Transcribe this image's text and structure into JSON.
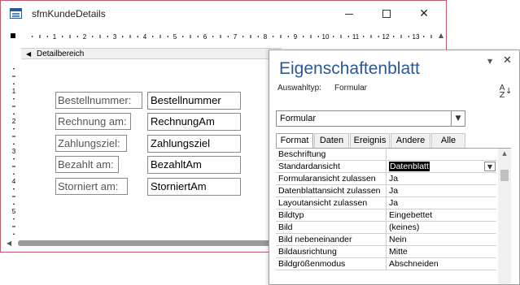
{
  "form_window": {
    "title": "sfmKundeDetails",
    "section_label": "Detailbereich",
    "ruler_numbers": [
      "1",
      "2",
      "3",
      "4",
      "5",
      "6",
      "7",
      "8",
      "9",
      "10",
      "11",
      "12",
      "13"
    ],
    "vertical_ruler_numbers": [
      "1",
      "2",
      "3",
      "4",
      "5"
    ],
    "controls": [
      {
        "label": "Bestellnummer:",
        "field": "Bestellnummer"
      },
      {
        "label": "Rechnung am:",
        "field": "RechnungAm"
      },
      {
        "label": "Zahlungsziel:",
        "field": "Zahlungsziel"
      },
      {
        "label": "Bezahlt am:",
        "field": "BezahltAm"
      },
      {
        "label": "Storniert am:",
        "field": "StorniertAm"
      }
    ],
    "accent_border_color": "#c25a6b"
  },
  "property_sheet": {
    "title": "Eigenschaftenblatt",
    "selection_caption": "Auswahltyp:",
    "selection_value": "Formular",
    "object_select": "Formular",
    "tabs": [
      "Format",
      "Daten",
      "Ereignis",
      "Andere",
      "Alle"
    ],
    "active_tab": "Format",
    "title_color": "#2b5797",
    "rows": [
      {
        "name": "Beschriftung",
        "value": ""
      },
      {
        "name": "Standardansicht",
        "value": "Datenblatt"
      },
      {
        "name": "Formularansicht zulassen",
        "value": "Ja"
      },
      {
        "name": "Datenblattansicht zulassen",
        "value": "Ja"
      },
      {
        "name": "Layoutansicht zulassen",
        "value": "Ja"
      },
      {
        "name": "Bildtyp",
        "value": "Eingebettet"
      },
      {
        "name": "Bild",
        "value": "(keines)"
      },
      {
        "name": "Bild nebeneinander",
        "value": "Nein"
      },
      {
        "name": "Bildausrichtung",
        "value": "Mitte"
      },
      {
        "name": "Bildgrößenmodus",
        "value": "Abschneiden"
      }
    ]
  }
}
